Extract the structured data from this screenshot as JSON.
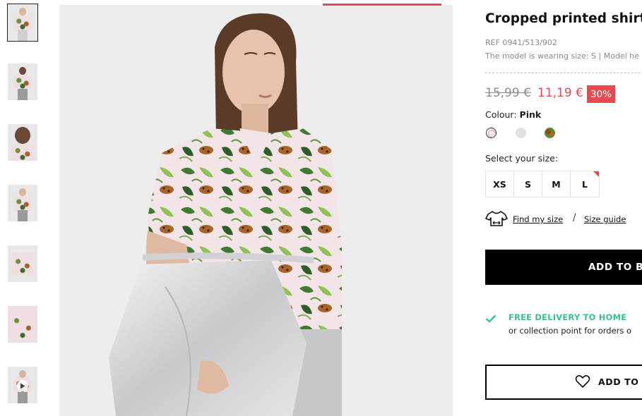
{
  "product": {
    "title": "Cropped printed shirt",
    "ref": "REF 0941/513/902",
    "model_info": "The model is wearing size: S | Model he",
    "old_price": "15,99 €",
    "new_price": "11,19 €",
    "discount": "30%"
  },
  "colour": {
    "label": "Colour:",
    "selected": "Pink",
    "swatches": [
      "#f7e6ec",
      "#e6dfdf",
      "#5a8a2f"
    ]
  },
  "sizes": {
    "label": "Select your size:",
    "options": [
      "XS",
      "S",
      "M",
      "L"
    ]
  },
  "fit": {
    "find_my_size": "Find my size",
    "separator": "/",
    "size_guide": "Size guide"
  },
  "actions": {
    "add_to_bag": "ADD TO BA",
    "add_to_wishlist": "ADD TO W"
  },
  "delivery": {
    "free": "FREE DELIVERY TO HOME",
    "collection": "or collection point for orders o"
  },
  "colors": {
    "accent": "#e84852",
    "delivery_green": "#3dbf8a"
  }
}
